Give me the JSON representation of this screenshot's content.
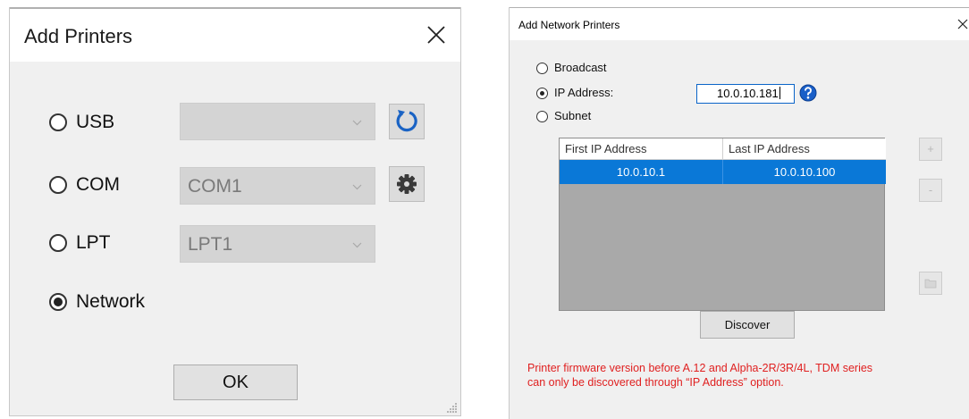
{
  "add_printers": {
    "title": "Add Printers",
    "options": [
      {
        "label": "USB",
        "selected": false,
        "combo_value": ""
      },
      {
        "label": "COM",
        "selected": false,
        "combo_value": "COM1"
      },
      {
        "label": "LPT",
        "selected": false,
        "combo_value": "LPT1"
      },
      {
        "label": "Network",
        "selected": true
      }
    ],
    "ok_label": "OK",
    "icons": {
      "close": "close-icon",
      "refresh": "refresh-icon",
      "settings": "gear-icon"
    }
  },
  "add_network_printers": {
    "title": "Add Network Printers",
    "modes": [
      {
        "label": "Broadcast",
        "selected": false
      },
      {
        "label": "IP Address:",
        "selected": true
      },
      {
        "label": "Subnet",
        "selected": false
      }
    ],
    "ip_address": "10.0.10.181",
    "table": {
      "columns": [
        "First IP Address",
        "Last IP Address"
      ],
      "rows": [
        [
          "10.0.10.1",
          "10.0.10.100"
        ]
      ]
    },
    "side_buttons": {
      "add": "+",
      "remove": "-"
    },
    "discover_label": "Discover",
    "warning_lines": [
      "Printer firmware version before A.12 and Alpha-2R/3R/4L, TDM series",
      "can only be discovered through “IP Address” option."
    ],
    "colors": {
      "selection": "#0a78d7",
      "warning": "#e02020",
      "help": "#1a5fc8"
    }
  }
}
